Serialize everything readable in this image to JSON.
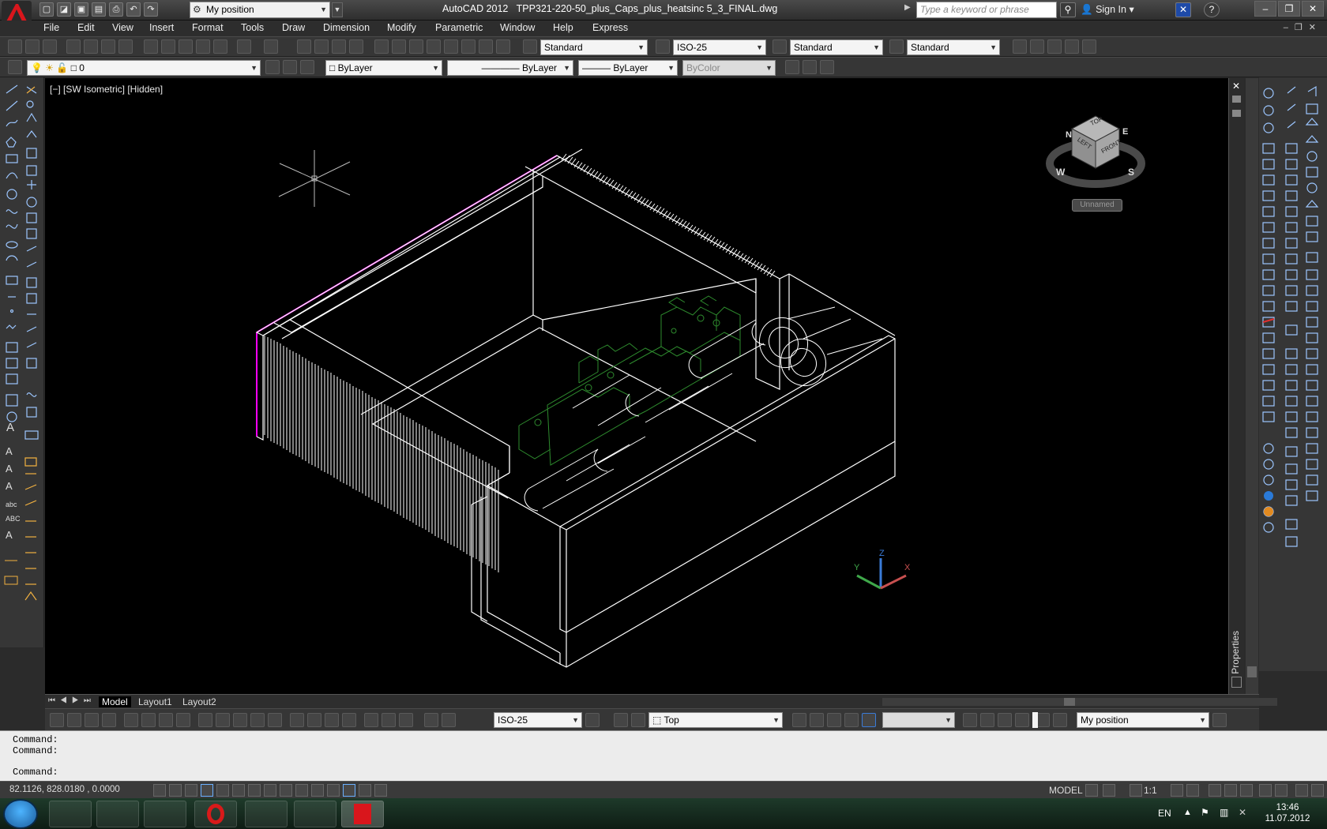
{
  "titlebar": {
    "app_title": "AutoCAD 2012",
    "file_name": "TPP321-220-50_plus_Caps_plus_heatsinc 5_3_FINAL.dwg",
    "workspace": "My position",
    "search_placeholder": "Type a keyword or phrase",
    "sign_in": "Sign In"
  },
  "menu": [
    "File",
    "Edit",
    "View",
    "Insert",
    "Format",
    "Tools",
    "Draw",
    "Dimension",
    "Modify",
    "Parametric",
    "Window",
    "Help",
    "Express"
  ],
  "styles": {
    "text_style": "Standard",
    "dim_style": "ISO-25",
    "table_style": "Standard",
    "multileader_style": "Standard"
  },
  "layers": {
    "current_layer": "0",
    "color": "ByLayer",
    "linetype": "ByLayer",
    "lineweight": "ByLayer",
    "plotstyle": "ByColor"
  },
  "viewport": {
    "label": "[−] [SW Isometric] [Hidden]",
    "named_view": "Unnamed",
    "viewcube": {
      "top": "TOP",
      "left": "LEFT",
      "front": "FRONT",
      "south": "S",
      "west": "W",
      "north": "N",
      "east": "E"
    },
    "ucs": {
      "x": "X",
      "y": "Y",
      "z": "Z"
    }
  },
  "palette": {
    "label": "Properties"
  },
  "tabs": [
    "Model",
    "Layout1",
    "Layout2"
  ],
  "bottom_toolbar": {
    "dim_style": "ISO-25",
    "view": "Top",
    "workspace": "My position"
  },
  "command": {
    "lines": [
      "Command:",
      "Command:",
      "",
      "Command:"
    ]
  },
  "status": {
    "coords": "82.1126, 828.0180 , 0.0000",
    "model": "MODEL",
    "scale": "1:1"
  },
  "taskbar": {
    "lang": "EN",
    "time": "13:46",
    "date": "11.07.2012"
  },
  "colors": {
    "accent": "#ff00ff",
    "wire": "#ffffff",
    "caps": "#2e8b2e",
    "background": "#000000"
  }
}
